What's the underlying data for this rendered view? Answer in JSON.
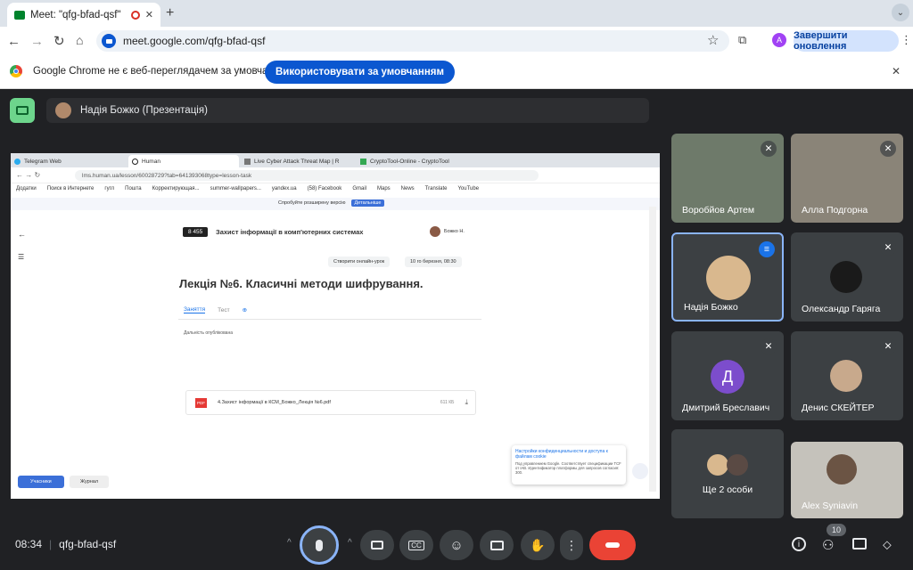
{
  "browser": {
    "tab_title": "Meet: \"qfg-bfad-qsf\"",
    "url": "meet.google.com/qfg-bfad-qsf",
    "profile_initial": "A",
    "update_button": "Завершити оновлення",
    "infobar_text": "Google Chrome не є веб-переглядачем за умовчанням",
    "infobar_button": "Використовувати за умовчанням"
  },
  "meet": {
    "presenter_label": "Надія Божко (Презентація)",
    "time": "08:34",
    "meeting_code": "qfg-bfad-qsf",
    "participants_count": "10"
  },
  "shared_screen": {
    "tabs": [
      "Telegram Web",
      "Human",
      "Live Cyber Attack Threat Map | R",
      "CryptoTool-Online - CryptoTool"
    ],
    "url": "lms.human.ua/lesson/60028729?tab=641393068type=lesson-task",
    "bookmarks": [
      "Додатки",
      "Поиск в Интернете",
      "гугл",
      "Пошта",
      "Корректирующая...",
      "summer-wallpapers...",
      "yandex.ua",
      "(58) Facebook",
      "Gmail",
      "Maps",
      "News",
      "Translate",
      "YouTube"
    ],
    "promo_text": "Спробуйте розширену версію",
    "promo_button": "Детальніше",
    "class_badge": "8 455",
    "course_title": "Захист інформації в комп'ютерних системах",
    "user_name": "Божко Н.",
    "create_online": "Створити онлайн-урок",
    "date": "10 го березня, 08:30",
    "lesson_title": "Лекція №6. Класичні методи шифрування.",
    "lesson_tabs": [
      "Заняття",
      "Тест"
    ],
    "published": "Дальність опублікована",
    "file_name": "4.Захист інформації в КСМ_Божко_Лекція №6.pdf",
    "file_size": "611 КБ",
    "file_type": "PDF",
    "cookie_title": "Настройки конфиденциальности и доступа к файлам cookie",
    "cookie_text": "Под управлением Google. Соответствует спецификации TCF от IAB. Идентификатор платформы для запросов согласия: 300.",
    "students_button": "Учасники",
    "journal_button": "Журнал"
  },
  "participants": [
    {
      "name": "Воробйов Артем",
      "muted": true
    },
    {
      "name": "Алла Подгорна",
      "muted": true
    },
    {
      "name": "Надія Божко",
      "muted": false,
      "speaking": true
    },
    {
      "name": "Олександр Гаряга",
      "muted": true
    },
    {
      "name": "Дмитрий Бреславич",
      "initial": "Д",
      "muted": true
    },
    {
      "name": "Денис СКЕЙТЕР",
      "muted": true
    },
    {
      "name": "Ще 2 особи"
    },
    {
      "name": "Alex Syniavin"
    }
  ],
  "colors": {
    "accent": "#0b57d0",
    "end_call": "#ea4335",
    "avatar_purple": "#7c4dcc",
    "speaking_border": "#8ab4f8"
  }
}
